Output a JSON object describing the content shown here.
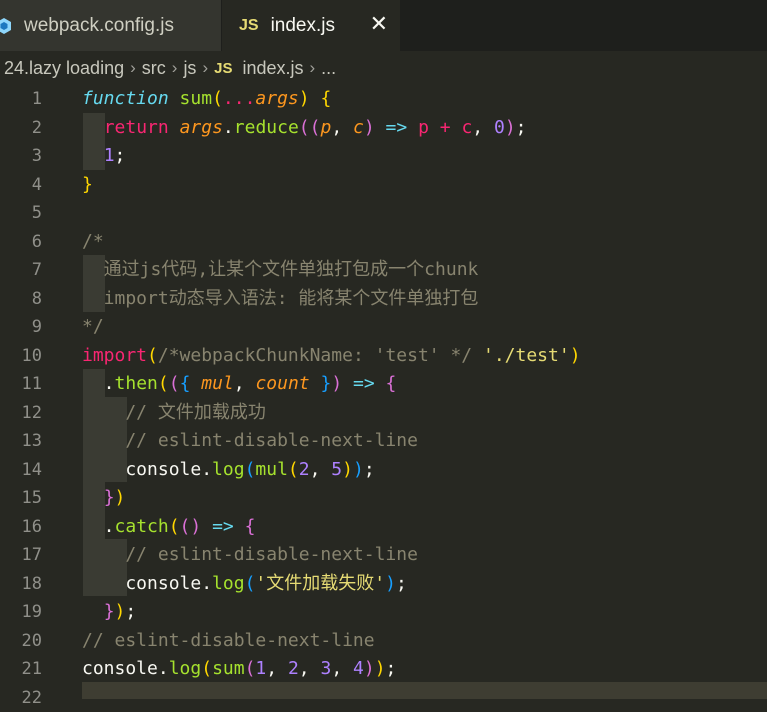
{
  "tabs": [
    {
      "label": "webpack.config.js",
      "icon": "webpack-icon",
      "active": false
    },
    {
      "label": "index.js",
      "icon": "js-icon",
      "icon_text": "JS",
      "active": true,
      "close": "✕"
    }
  ],
  "breadcrumb": {
    "items": [
      "24.lazy loading",
      "src",
      "js",
      "index.js",
      "..."
    ],
    "file_icon_text": "JS",
    "separator": "›"
  },
  "editor": {
    "line_numbers": [
      "1",
      "2",
      "3",
      "4",
      "5",
      "6",
      "7",
      "8",
      "9",
      "10",
      "11",
      "12",
      "13",
      "14",
      "15",
      "16",
      "17",
      "18",
      "19",
      "20",
      "21",
      "22"
    ],
    "lines": [
      [
        [
          "kw-i",
          "function"
        ],
        [
          "pl",
          " "
        ],
        [
          "fn",
          "sum"
        ],
        [
          "b1",
          "("
        ],
        [
          "kw",
          "..."
        ],
        [
          "par",
          "args"
        ],
        [
          "b1",
          ")"
        ],
        [
          "pl",
          " "
        ],
        [
          "b1",
          "{"
        ]
      ],
      [
        [
          "pl",
          "  "
        ],
        [
          "kw",
          "return"
        ],
        [
          "pl",
          " "
        ],
        [
          "par",
          "args"
        ],
        [
          "pl",
          "."
        ],
        [
          "fn",
          "reduce"
        ],
        [
          "b2",
          "(("
        ],
        [
          "par",
          "p"
        ],
        [
          "pl",
          ", "
        ],
        [
          "par",
          "c"
        ],
        [
          "b2",
          ")"
        ],
        [
          "pl",
          " "
        ],
        [
          "kw-i",
          "=>"
        ],
        [
          "pl",
          " "
        ],
        [
          "kw",
          "p"
        ],
        [
          "pl",
          " "
        ],
        [
          "kw",
          "+"
        ],
        [
          "pl",
          " "
        ],
        [
          "kw",
          "c"
        ],
        [
          "pl",
          ", "
        ],
        [
          "num",
          "0"
        ],
        [
          "b2",
          ")"
        ],
        [
          "pl",
          ";"
        ]
      ],
      [
        [
          "pl",
          "  "
        ],
        [
          "num",
          "1"
        ],
        [
          "pl",
          ";"
        ]
      ],
      [
        [
          "b1",
          "}"
        ]
      ],
      [],
      [
        [
          "cm",
          "/*"
        ]
      ],
      [
        [
          "cm",
          "  通过js代码,让某个文件单独打包成一个chunk"
        ]
      ],
      [
        [
          "cm",
          "  import动态导入语法: 能将某个文件单独打包"
        ]
      ],
      [
        [
          "cm",
          "*/"
        ]
      ],
      [
        [
          "kw",
          "import"
        ],
        [
          "b1",
          "("
        ],
        [
          "cm",
          "/*webpackChunkName: 'test' */"
        ],
        [
          "pl",
          " "
        ],
        [
          "str",
          "'./test'"
        ],
        [
          "b1",
          ")"
        ]
      ],
      [
        [
          "pl",
          "  ."
        ],
        [
          "fn",
          "then"
        ],
        [
          "b1",
          "("
        ],
        [
          "b2",
          "("
        ],
        [
          "b3",
          "{"
        ],
        [
          "pl",
          " "
        ],
        [
          "par",
          "mul"
        ],
        [
          "pl",
          ", "
        ],
        [
          "par",
          "count"
        ],
        [
          "pl",
          " "
        ],
        [
          "b3",
          "}"
        ],
        [
          "b2",
          ")"
        ],
        [
          "pl",
          " "
        ],
        [
          "kw-i",
          "=>"
        ],
        [
          "pl",
          " "
        ],
        [
          "b2",
          "{"
        ]
      ],
      [
        [
          "cm",
          "    // 文件加载成功"
        ]
      ],
      [
        [
          "cm",
          "    // eslint-disable-next-line"
        ]
      ],
      [
        [
          "pl",
          "    console."
        ],
        [
          "fn",
          "log"
        ],
        [
          "b3",
          "("
        ],
        [
          "fn",
          "mul"
        ],
        [
          "b1",
          "("
        ],
        [
          "num",
          "2"
        ],
        [
          "pl",
          ", "
        ],
        [
          "num",
          "5"
        ],
        [
          "b1",
          ")"
        ],
        [
          "b3",
          ")"
        ],
        [
          "pl",
          ";"
        ]
      ],
      [
        [
          "pl",
          "  "
        ],
        [
          "b2",
          "}"
        ],
        [
          "b1",
          ")"
        ]
      ],
      [
        [
          "pl",
          "  ."
        ],
        [
          "fn",
          "catch"
        ],
        [
          "b1",
          "("
        ],
        [
          "b2",
          "()"
        ],
        [
          "pl",
          " "
        ],
        [
          "kw-i",
          "=>"
        ],
        [
          "pl",
          " "
        ],
        [
          "b2",
          "{"
        ]
      ],
      [
        [
          "cm",
          "    // eslint-disable-next-line"
        ]
      ],
      [
        [
          "pl",
          "    console."
        ],
        [
          "fn",
          "log"
        ],
        [
          "b3",
          "("
        ],
        [
          "str",
          "'文件加载失败'"
        ],
        [
          "b3",
          ")"
        ],
        [
          "pl",
          ";"
        ]
      ],
      [
        [
          "pl",
          "  "
        ],
        [
          "b2",
          "}"
        ],
        [
          "b1",
          ")"
        ],
        [
          "pl",
          ";"
        ]
      ],
      [
        [
          "cm",
          "// eslint-disable-next-line"
        ]
      ],
      [
        [
          "pl",
          "console."
        ],
        [
          "fn",
          "log"
        ],
        [
          "b1",
          "("
        ],
        [
          "fn",
          "sum"
        ],
        [
          "b2",
          "("
        ],
        [
          "num",
          "1"
        ],
        [
          "pl",
          ", "
        ],
        [
          "num",
          "2"
        ],
        [
          "pl",
          ", "
        ],
        [
          "num",
          "3"
        ],
        [
          "pl",
          ", "
        ],
        [
          "num",
          "4"
        ],
        [
          "b2",
          ")"
        ],
        [
          "b1",
          ")"
        ],
        [
          "pl",
          ";"
        ]
      ],
      []
    ]
  },
  "colors": {
    "background": "#272822",
    "tab_bar": "#1e1f1c",
    "line_numbers": "#90908a"
  }
}
